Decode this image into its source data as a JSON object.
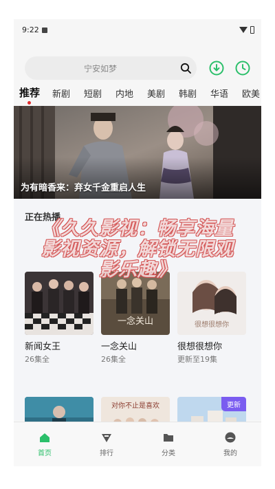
{
  "status_bar": {
    "time": "9:22"
  },
  "search": {
    "placeholder": "宁安如梦"
  },
  "header_icons": [
    "download-icon",
    "history-icon"
  ],
  "tabs": [
    {
      "label": "推荐",
      "active": true
    },
    {
      "label": "新剧"
    },
    {
      "label": "短剧"
    },
    {
      "label": "内地"
    },
    {
      "label": "美剧"
    },
    {
      "label": "韩剧"
    },
    {
      "label": "华语"
    },
    {
      "label": "欧美"
    }
  ],
  "banner": {
    "title": "为有暗香来：弃女千金重启人生"
  },
  "section": {
    "title": "正在热播"
  },
  "cards": [
    {
      "name": "新闻女王",
      "sub": "26集全"
    },
    {
      "name": "一念关山",
      "sub": "26集全",
      "poster_text": "一念关山"
    },
    {
      "name": "很想很想你",
      "sub": "更新至19集",
      "poster_text": "很想很想你"
    },
    {
      "name": "",
      "sub": ""
    },
    {
      "name": "",
      "sub": "",
      "poster_text": "对你不止是喜欢"
    },
    {
      "name": "",
      "sub": "",
      "badge": "更新"
    }
  ],
  "bottom_nav": [
    {
      "label": "首页",
      "icon": "home-icon",
      "active": true
    },
    {
      "label": "排行",
      "icon": "ranking-icon"
    },
    {
      "label": "分类",
      "icon": "folder-icon"
    },
    {
      "label": "我的",
      "icon": "profile-icon"
    }
  ],
  "overlay": {
    "line1": "《久久影视：畅享海量",
    "line2": "影视资源，解锁无限观",
    "line3": "影乐趣》"
  },
  "colors": {
    "accent": "#2bbf6a",
    "badge": "#7a5cf0",
    "tab_dot": "#e02b2b"
  }
}
